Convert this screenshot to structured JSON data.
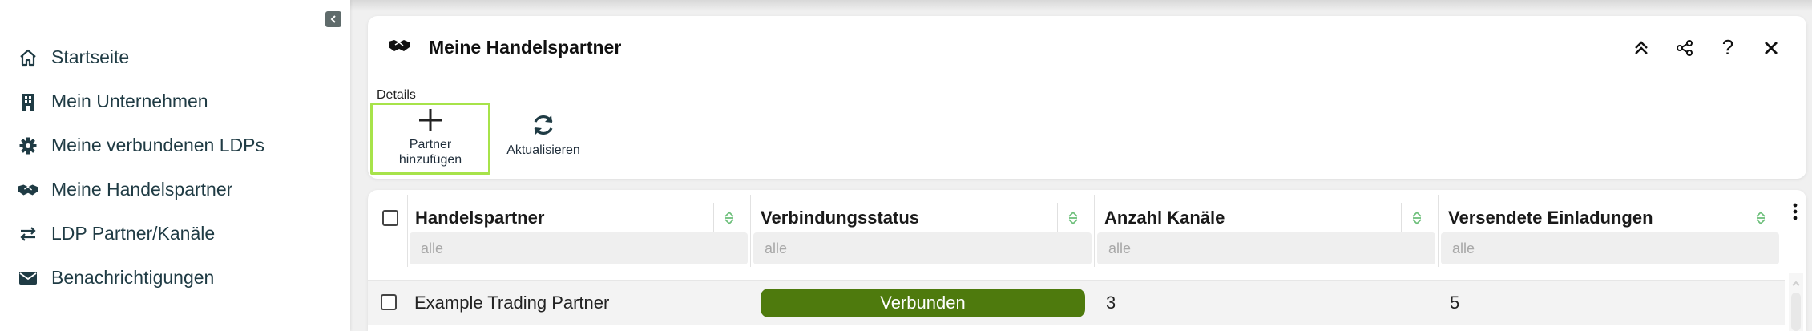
{
  "sidebar": {
    "items": [
      {
        "label": "Startseite",
        "icon": "home-icon"
      },
      {
        "label": "Mein Unternehmen",
        "icon": "building-icon"
      },
      {
        "label": "Meine verbundenen LDPs",
        "icon": "gear-icon"
      },
      {
        "label": "Meine Handelspartner",
        "icon": "handshake-icon"
      },
      {
        "label": "LDP Partner/Kanäle",
        "icon": "swap-arrows-icon"
      },
      {
        "label": "Benachrichtigungen",
        "icon": "envelope-icon"
      }
    ]
  },
  "panel": {
    "title": "Meine Handelspartner",
    "section_label": "Details",
    "add_partner_label_1": "Partner",
    "add_partner_label_2": "hinzufügen",
    "refresh_label": "Aktualisieren"
  },
  "grid": {
    "columns": [
      {
        "header": "Handelspartner",
        "filter_placeholder": "alle"
      },
      {
        "header": "Verbindungsstatus",
        "filter_placeholder": "alle"
      },
      {
        "header": "Anzahl Kanäle",
        "filter_placeholder": "alle"
      },
      {
        "header": "Versendete Einladungen",
        "filter_placeholder": "alle"
      }
    ],
    "rows": [
      {
        "partner": "Example Trading Partner",
        "status": "Verbunden",
        "channels": "3",
        "invitations": "5"
      }
    ]
  },
  "colors": {
    "status_connected": "#4e7a0d",
    "highlight_border": "#a7e34a",
    "sort_icon": "#6dbf7a"
  }
}
